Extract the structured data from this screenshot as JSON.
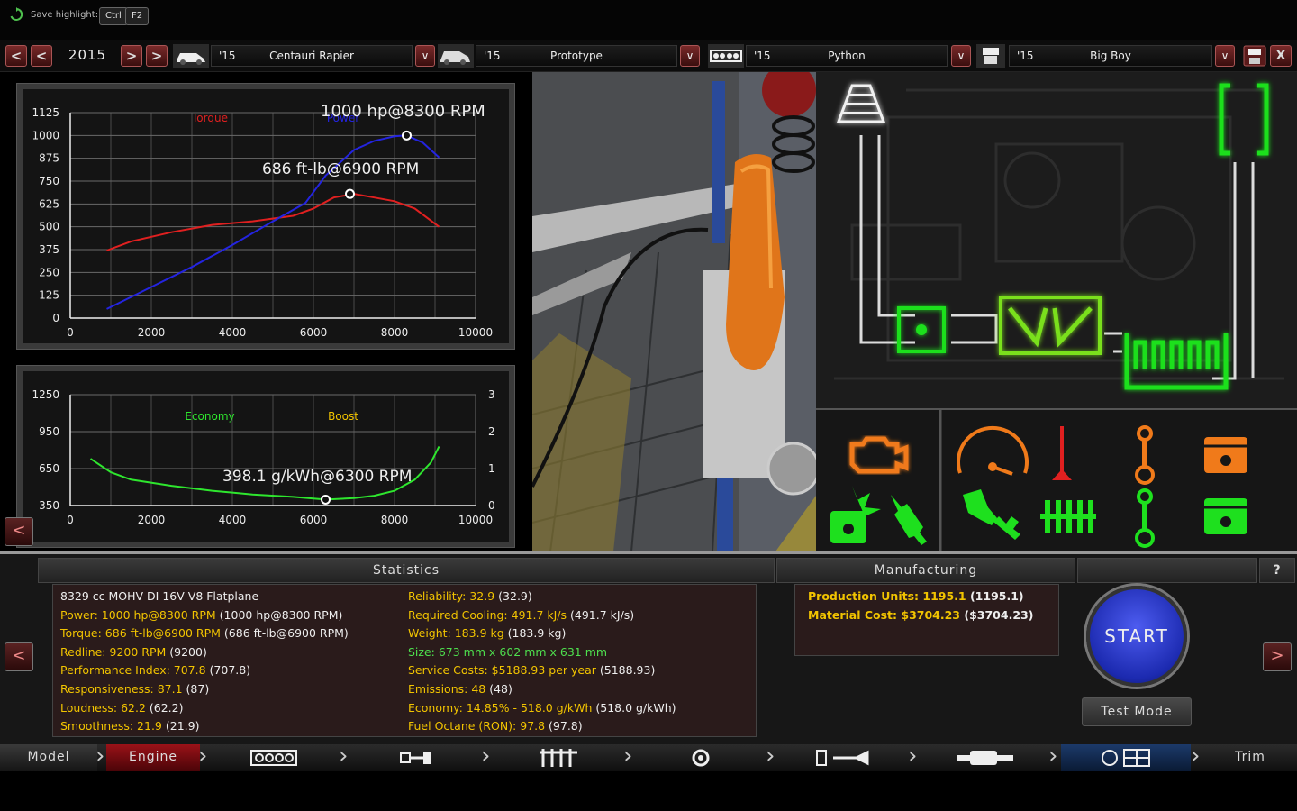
{
  "hint": {
    "label": "Save highlight:",
    "keys": [
      "Ctrl",
      "F2"
    ]
  },
  "selector": {
    "year": "2015",
    "model": {
      "year": "'15",
      "name": "Centauri  Rapier"
    },
    "trim": {
      "year": "'15",
      "name": "Prototype"
    },
    "engine": {
      "year": "'15",
      "name": "Python"
    },
    "variant": {
      "year": "'15",
      "name": "Big Boy"
    },
    "prev2": "<",
    "prev": "<",
    "next": ">",
    "next2": ">",
    "dropdown": "v",
    "save": "save-icon",
    "close": "X"
  },
  "power_chart": {
    "torque_label": "Torque",
    "power_label": "Power",
    "power_peak": "1000 hp@8300 RPM",
    "torque_peak": "686 ft-lb@6900 RPM"
  },
  "economy_chart": {
    "economy_label": "Economy",
    "boost_label": "Boost",
    "economy_peak": "398.1 g/kWh@6300 RPM"
  },
  "chart_data": [
    {
      "type": "line",
      "x_ticks": [
        "0",
        "2000",
        "4000",
        "6000",
        "8000",
        "10000"
      ],
      "y_ticks": [
        "0",
        "125",
        "250",
        "375",
        "500",
        "625",
        "750",
        "875",
        "1000",
        "1125"
      ],
      "xlim": [
        0,
        10000
      ],
      "ylim": [
        0,
        1125
      ],
      "series": [
        {
          "name": "Torque",
          "color": "#e02020",
          "x": [
            900,
            1500,
            2500,
            3500,
            4500,
            5500,
            6000,
            6500,
            7000,
            7500,
            8000,
            8500,
            9100
          ],
          "y": [
            370,
            420,
            470,
            510,
            530,
            560,
            600,
            660,
            680,
            660,
            640,
            600,
            500
          ]
        },
        {
          "name": "Power",
          "color": "#2424e0",
          "x": [
            900,
            2000,
            3000,
            4000,
            5000,
            5800,
            6300,
            7000,
            7500,
            8000,
            8300,
            8700,
            9100
          ],
          "y": [
            50,
            170,
            280,
            400,
            530,
            630,
            780,
            920,
            970,
            995,
            1000,
            960,
            880
          ]
        }
      ],
      "markers": [
        {
          "x": 8300,
          "y": 1000
        },
        {
          "x": 6900,
          "y": 680
        }
      ]
    },
    {
      "type": "line",
      "x_ticks": [
        "0",
        "2000",
        "4000",
        "6000",
        "8000",
        "10000"
      ],
      "y_ticks": [
        "350",
        "650",
        "950",
        "1250"
      ],
      "y2_ticks": [
        "0",
        "1",
        "2",
        "3"
      ],
      "xlim": [
        0,
        10000
      ],
      "ylim": [
        350,
        1250
      ],
      "series": [
        {
          "name": "Economy",
          "color": "#2ee62e",
          "x": [
            500,
            1000,
            1500,
            2500,
            3500,
            4500,
            5500,
            6300,
            7000,
            7500,
            8000,
            8500,
            8900,
            9100
          ],
          "y": [
            730,
            620,
            560,
            510,
            470,
            440,
            420,
            398,
            410,
            430,
            470,
            560,
            700,
            830
          ]
        }
      ],
      "markers": [
        {
          "x": 6300,
          "y": 398
        }
      ]
    }
  ],
  "statistics": {
    "title": "Statistics",
    "left": [
      {
        "label": "8329 cc MOHV DI 16V V8 Flatplane",
        "value": ""
      },
      {
        "label": "Power: 1000 hp@8300 RPM",
        "value": " (1000 hp@8300 RPM)"
      },
      {
        "label": "Torque: 686 ft-lb@6900 RPM",
        "value": " (686 ft-lb@6900 RPM)"
      },
      {
        "label": "Redline: 9200 RPM",
        "value": " (9200)"
      },
      {
        "label": "Performance Index: 707.8",
        "value": " (707.8)"
      },
      {
        "label": "Responsiveness: 87.1",
        "value": " (87)"
      },
      {
        "label": "Loudness: 62.2",
        "value": " (62.2)"
      },
      {
        "label": "Smoothness: 21.9",
        "value": " (21.9)"
      }
    ],
    "right": [
      {
        "label": "Reliability: 32.9",
        "value": " (32.9)"
      },
      {
        "label": "Required Cooling: 491.7 kJ/s",
        "value": " (491.7 kJ/s)"
      },
      {
        "label": "Weight: 183.9 kg",
        "value": " (183.9 kg)"
      },
      {
        "label": "Size: 673 mm x 602 mm x 631 mm",
        "value": ""
      },
      {
        "label": "Service Costs: $5188.93 per year",
        "value": " (5188.93)"
      },
      {
        "label": "Emissions: 48",
        "value": " (48)"
      },
      {
        "label": "Economy: 14.85% - 518.0 g/kWh",
        "value": " (518.0 g/kWh)"
      },
      {
        "label": "Fuel Octane (RON): 97.8",
        "value": " (97.8)"
      }
    ]
  },
  "manufacturing": {
    "title": "Manufacturing",
    "rows": [
      {
        "label": "Production Units: 1195.1",
        "value": " (1195.1)"
      },
      {
        "label": "Material Cost: $3704.23",
        "value": " ($3704.23)"
      }
    ]
  },
  "help": "?",
  "start": "START",
  "test_mode": "Test Mode",
  "nav": {
    "model": "Model",
    "engine": "Engine",
    "trim": "Trim"
  },
  "colors": {
    "accent_red": "#c0141c",
    "stat_yellow": "#f2c400",
    "stat_green": "#4ee04e",
    "start_blue": "#2a3ad0"
  }
}
